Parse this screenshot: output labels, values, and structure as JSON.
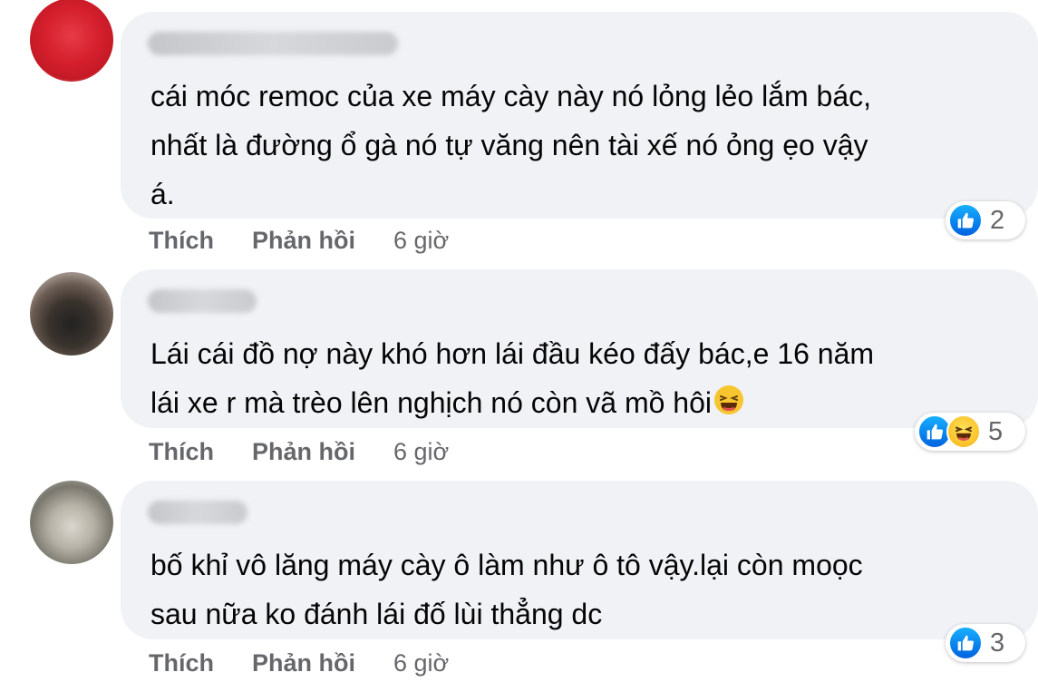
{
  "comments": [
    {
      "text": "cái móc remoc của xe máy cày này nó lỏng lẻo lắm bác,\nnhất là đường ổ gà nó tự văng nên tài xế nó ỏng ẹo vậy\ná.",
      "reactions": [
        "like"
      ],
      "reaction_count": "2",
      "like_label": "Thích",
      "reply_label": "Phản hồi",
      "time": "6 giờ"
    },
    {
      "text": "Lái cái đồ nợ này khó hơn lái đầu kéo đấy bác,e 16 năm\nlái xe r mà trèo lên nghịch nó còn vã mồ hôi",
      "reactions": [
        "like",
        "haha"
      ],
      "reaction_count": "5",
      "like_label": "Thích",
      "reply_label": "Phản hồi",
      "time": "6 giờ"
    },
    {
      "text": "bố khỉ vô lăng máy cày ô làm như ô tô vậy.lại còn moọc\nsau nữa ko đánh lái đố lùi thẳng dc",
      "reactions": [
        "like"
      ],
      "reaction_count": "3",
      "like_label": "Thích",
      "reply_label": "Phản hồi",
      "time": "6 giờ"
    }
  ],
  "colors": {
    "bubble": "#f0f2f5",
    "text": "#050505",
    "secondary": "#65676b",
    "like": "#1877f2",
    "haha": "#f7c52e"
  }
}
